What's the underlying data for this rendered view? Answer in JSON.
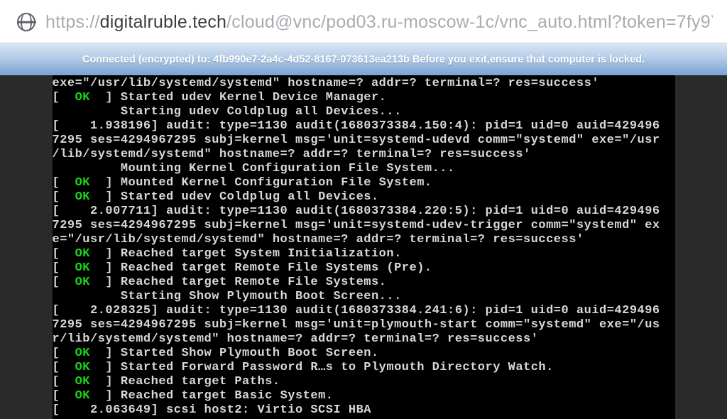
{
  "url": {
    "scheme": "https://",
    "host": "digitalruble.tech",
    "path": "/cloud@vnc/pod03.ru-moscow-1c/vnc_auto.html?token=7fy9Yd3ou..."
  },
  "banner": "Connected (encrypted) to: 4fb990e7-2a4c-4d52-8167-073613ea213b Before you exit,ensure that computer is locked.",
  "terminal_lines": [
    {
      "status": null,
      "text": "exe=\"/usr/lib/systemd/systemd\" hostname=? addr=? terminal=? res=success'"
    },
    {
      "status": "OK",
      "text": "Started udev Kernel Device Manager."
    },
    {
      "status": null,
      "text": "         Starting udev Coldplug all Devices..."
    },
    {
      "status": null,
      "text": "[    1.938196] audit: type=1130 audit(1680373384.150:4): pid=1 uid=0 auid=429496"
    },
    {
      "status": null,
      "text": "7295 ses=4294967295 subj=kernel msg='unit=systemd-udevd comm=\"systemd\" exe=\"/usr"
    },
    {
      "status": null,
      "text": "/lib/systemd/systemd\" hostname=? addr=? terminal=? res=success'"
    },
    {
      "status": null,
      "text": "         Mounting Kernel Configuration File System..."
    },
    {
      "status": "OK",
      "text": "Mounted Kernel Configuration File System."
    },
    {
      "status": "OK",
      "text": "Started udev Coldplug all Devices."
    },
    {
      "status": null,
      "text": "[    2.007711] audit: type=1130 audit(1680373384.220:5): pid=1 uid=0 auid=429496"
    },
    {
      "status": null,
      "text": "7295 ses=4294967295 subj=kernel msg='unit=systemd-udev-trigger comm=\"systemd\" ex"
    },
    {
      "status": null,
      "text": "e=\"/usr/lib/systemd/systemd\" hostname=? addr=? terminal=? res=success'"
    },
    {
      "status": "OK",
      "text": "Reached target System Initialization."
    },
    {
      "status": "OK",
      "text": "Reached target Remote File Systems (Pre)."
    },
    {
      "status": "OK",
      "text": "Reached target Remote File Systems."
    },
    {
      "status": null,
      "text": "         Starting Show Plymouth Boot Screen..."
    },
    {
      "status": null,
      "text": "[    2.028325] audit: type=1130 audit(1680373384.241:6): pid=1 uid=0 auid=429496"
    },
    {
      "status": null,
      "text": "7295 ses=4294967295 subj=kernel msg='unit=plymouth-start comm=\"systemd\" exe=\"/us"
    },
    {
      "status": null,
      "text": "r/lib/systemd/systemd\" hostname=? addr=? terminal=? res=success'"
    },
    {
      "status": "OK",
      "text": "Started Show Plymouth Boot Screen."
    },
    {
      "status": "OK",
      "text": "Started Forward Password R…s to Plymouth Directory Watch."
    },
    {
      "status": "OK",
      "text": "Reached target Paths."
    },
    {
      "status": "OK",
      "text": "Reached target Basic System."
    },
    {
      "status": null,
      "text": "[    2.063649] scsi host2: Virtio SCSI HBA"
    }
  ]
}
